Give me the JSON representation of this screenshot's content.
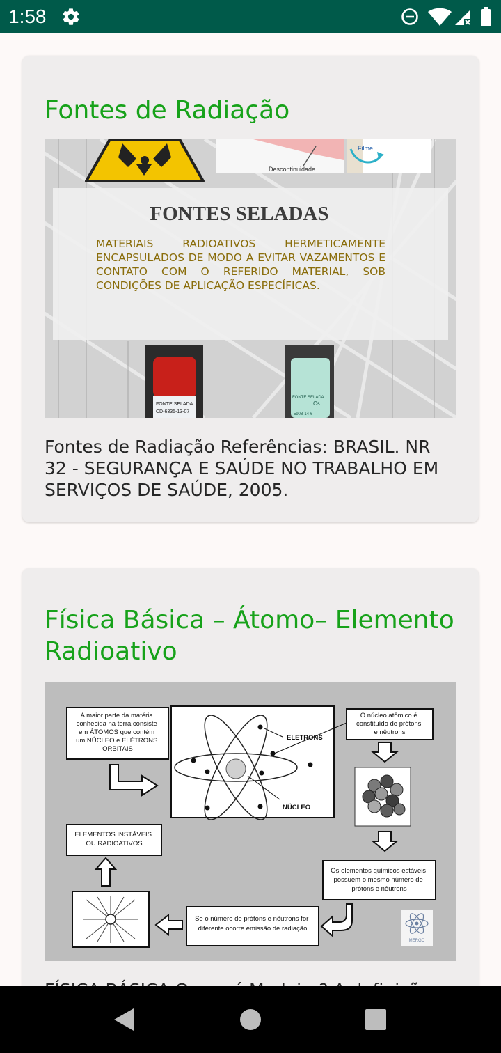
{
  "status_bar": {
    "time": "1:58",
    "background_color": "#005a4a",
    "icons": [
      "gear-icon",
      "do-not-disturb-icon",
      "wifi-icon",
      "cell-signal-icon",
      "battery-icon"
    ]
  },
  "theme": {
    "title_color": "#17a21a",
    "card_color": "#efeded",
    "background_color": "#fdf9f8"
  },
  "cards": [
    {
      "title": "Fontes de Radiação",
      "image": {
        "heading": "FONTES SELADAS",
        "body": "MATERIAIS RADIOATIVOS HERMETICAMENTE ENCAPSULADOS DE MODO A EVITAR VAZAMENTOS E CONTATO COM O REFERIDO MATERIAL, SOB CONDIÇÕES DE APLICAÇÃO ESPECÍFICAS.",
        "label_descontinuidade": "Descontinuidade",
        "label_filme": "Filme",
        "bottle1_label": "FONTE SELADA",
        "bottle1_code": "CD-6335-13-07",
        "bottle2_label": "FONTE SELADA",
        "bottle2_element": "Cs",
        "bottle2_code": "5908-14-6"
      },
      "text": "Fontes de Radiação Referências: BRASIL. NR 32 - SEGURANÇA E SAÚDE NO TRABALHO EM SERVIÇOS DE SAÚDE, 2005."
    },
    {
      "title": "Física Básica – Átomo– Elemento Radioativo",
      "image": {
        "box_materia": [
          "A maior parte da matéria",
          "conhecida na terra consiste",
          "em ÁTOMOS que contém",
          "um NÚCLEO e ELÉTRONS",
          "ORBITAIS"
        ],
        "label_eletrons": "ELETRONS",
        "label_nucleo": "NÚCLEO",
        "box_nucleo": [
          "O núcleo atômico é",
          "constituído de prótons",
          "e nêutrons"
        ],
        "box_instaveis": [
          "ELEMENTOS INSTÁVEIS",
          "OU RADIOATIVOS"
        ],
        "box_estaveis": [
          "Os elementos químicos estáveis",
          "possuem o mesmo número de",
          "prótons e nêutrons"
        ],
        "box_emissao": [
          "Se o número de prótons e nêutrons for",
          "diferente ocorre emissão de radiação"
        ],
        "logo_text": "MERGO"
      },
      "text": "FÍSICA BÁSICA Quem é Madeiro? A definição"
    }
  ],
  "nav_bar": {
    "buttons": [
      "back-icon",
      "home-icon",
      "recents-icon"
    ]
  }
}
